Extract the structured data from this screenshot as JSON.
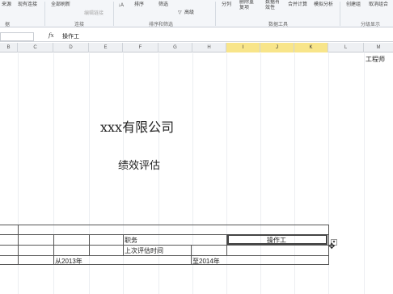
{
  "ribbon": {
    "row1": [
      {
        "label": "来源"
      },
      {
        "label": "现有连接"
      },
      {
        "label": "全部刷新"
      },
      {
        "label": "编辑链接"
      },
      {
        "label": "排序"
      },
      {
        "label": "筛选"
      },
      {
        "label": "高级"
      },
      {
        "label": "分列"
      },
      {
        "label": "删除重复项"
      },
      {
        "label": "数据有效性"
      },
      {
        "label": "合并计算"
      },
      {
        "label": "模拟分析"
      },
      {
        "label": "创建组"
      },
      {
        "label": "取消组合"
      }
    ],
    "groups": [
      "据",
      "连接",
      "排序和筛选",
      "数据工具",
      "分级显示"
    ]
  },
  "formula_bar": {
    "fx": "fx",
    "content": "操作工"
  },
  "columns": [
    "B",
    "C",
    "D",
    "E",
    "F",
    "G",
    "H",
    "I",
    "J",
    "K",
    "L",
    "M"
  ],
  "selected_columns": [
    "I",
    "J",
    "K"
  ],
  "sheet": {
    "corner_text": "工程师",
    "company": "xxx有限公司",
    "subtitle": "绩效评估",
    "label_position": "职务",
    "value_position": "操作工",
    "label_last_review": "上次评估时间",
    "from_year": "从2013年",
    "to_year": "至2014年"
  },
  "colors": {
    "selected_column": "#f8e58a",
    "ribbon_bg": "#f4f6f9"
  }
}
